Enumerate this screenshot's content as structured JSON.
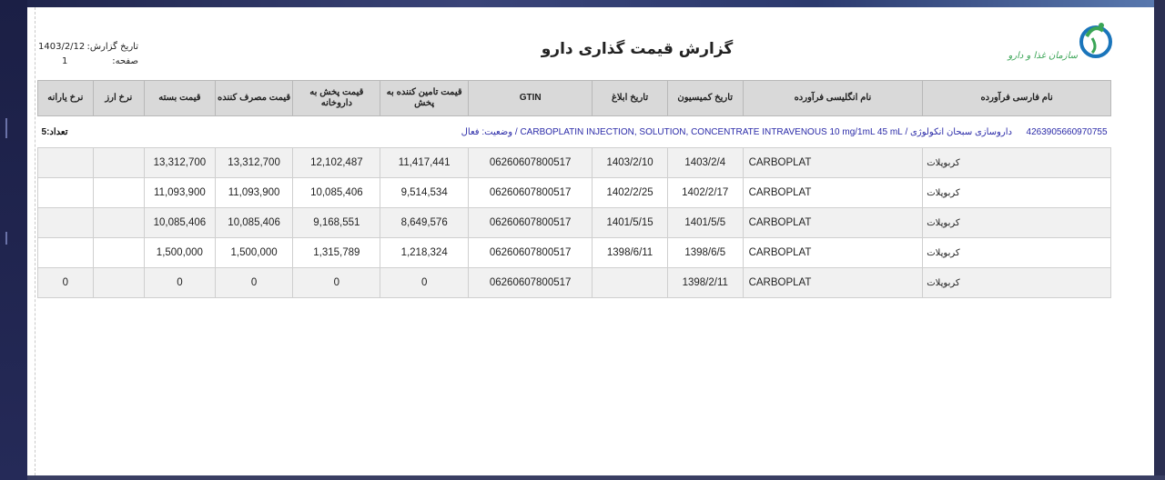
{
  "report": {
    "title": "گزارش قیمت گذاری دارو",
    "date_label": "تاریخ گزارش:",
    "date_value": "1403/2/12",
    "page_label": "صفحه:",
    "page_value": "1"
  },
  "logo": {
    "text": "سازمان غذا و دارو",
    "icon": "fda-logo-icon"
  },
  "table": {
    "headers": [
      "نام فارسی فرآورده",
      "نام انگلیسی فرآورده",
      "تاریخ کمیسیون",
      "تاریخ ابلاغ",
      "GTIN",
      "قیمت تامین کننده به پخش",
      "قیمت پخش به داروخانه",
      "قیمت مصرف کننده",
      "قیمت بسته",
      "نرخ ارز",
      "نرخ یارانه"
    ],
    "group": {
      "code": "4263905660970755",
      "description": "داروسازی سبحان انکولوژی / CARBOPLATIN INJECTION, SOLUTION, CONCENTRATE INTRAVENOUS 10 mg/1mL 45 mL / وضعیت: فعال",
      "count": "تعداد:5"
    },
    "rows": [
      {
        "fa_name": "کربوپلات",
        "en_name": "CARBOPLAT",
        "commission": "1403/2/4",
        "notify": "1403/2/10",
        "gtin": "06260607800517",
        "supplier_price": "11,417,441",
        "distribution_price": "12,102,487",
        "consumer_price": "13,312,700",
        "pack_price": "13,312,700",
        "fx_rate": "",
        "subsidy_rate": ""
      },
      {
        "fa_name": "کربوپلات",
        "en_name": "CARBOPLAT",
        "commission": "1402/2/17",
        "notify": "1402/2/25",
        "gtin": "06260607800517",
        "supplier_price": "9,514,534",
        "distribution_price": "10,085,406",
        "consumer_price": "11,093,900",
        "pack_price": "11,093,900",
        "fx_rate": "",
        "subsidy_rate": ""
      },
      {
        "fa_name": "کربوپلات",
        "en_name": "CARBOPLAT",
        "commission": "1401/5/5",
        "notify": "1401/5/15",
        "gtin": "06260607800517",
        "supplier_price": "8,649,576",
        "distribution_price": "9,168,551",
        "consumer_price": "10,085,406",
        "pack_price": "10,085,406",
        "fx_rate": "",
        "subsidy_rate": ""
      },
      {
        "fa_name": "کربوپلات",
        "en_name": "CARBOPLAT",
        "commission": "1398/6/5",
        "notify": "1398/6/11",
        "gtin": "06260607800517",
        "supplier_price": "1,218,324",
        "distribution_price": "1,315,789",
        "consumer_price": "1,500,000",
        "pack_price": "1,500,000",
        "fx_rate": "",
        "subsidy_rate": ""
      },
      {
        "fa_name": "کربوپلات",
        "en_name": "CARBOPLAT",
        "commission": "1398/2/11",
        "notify": "",
        "gtin": "06260607800517",
        "supplier_price": "0",
        "distribution_price": "0",
        "consumer_price": "0",
        "pack_price": "0",
        "fx_rate": "",
        "subsidy_rate": "0"
      }
    ]
  }
}
